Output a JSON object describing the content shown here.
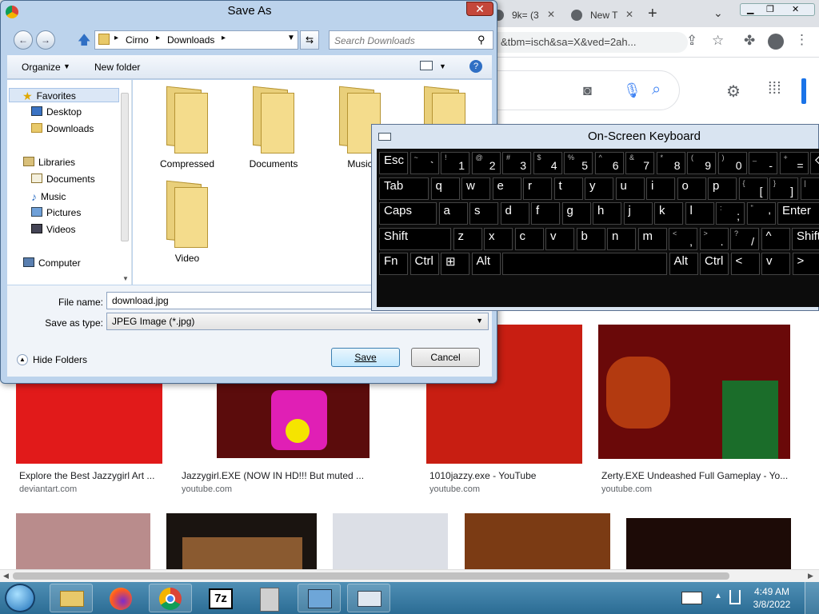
{
  "browser": {
    "tabs": [
      {
        "label": ""
      },
      {
        "label": ""
      },
      {
        "label": ""
      },
      {
        "label": ""
      },
      {
        "label": ""
      },
      {
        "label": "9k= (3"
      },
      {
        "label": "New T"
      }
    ],
    "new_tab_label": "+",
    "address": "&tbm=isch&sa=X&ved=2ah..."
  },
  "results": [
    {
      "caption": "Explore the Best Jazzygirl Art ...",
      "source": "deviantart.com",
      "color": "#e11a1a"
    },
    {
      "caption": "Jazzygirl.EXE (NOW IN HD!!! But muted ...",
      "source": "youtube.com",
      "color": "#5b0c0c"
    },
    {
      "caption": "1010jazzy.exe - YouTube",
      "source": "youtube.com",
      "color": "#c81e12"
    },
    {
      "caption": "Zerty.EXE Undeashed Full Gameplay - Yo...",
      "source": "youtube.com",
      "color": "#6a0909"
    }
  ],
  "dialog": {
    "title": "Save As",
    "close": "✕",
    "path": [
      "Cirno",
      "Downloads"
    ],
    "search_placeholder": "Search Downloads",
    "organize": "Organize",
    "new_folder": "New folder",
    "nav": {
      "favorites": "Favorites",
      "desktop": "Desktop",
      "downloads": "Downloads",
      "libraries": "Libraries",
      "documents": "Documents",
      "music": "Music",
      "pictures": "Pictures",
      "videos": "Videos",
      "computer": "Computer"
    },
    "folders": [
      "Compressed",
      "Documents",
      "Music",
      "",
      "Video"
    ],
    "file_name_label": "File name:",
    "file_name_value": "download.jpg",
    "save_type_label": "Save as type:",
    "save_type_value": "JPEG Image (*.jpg)",
    "hide_folders": "Hide Folders",
    "save": "Save",
    "cancel": "Cancel"
  },
  "osk": {
    "title": "On-Screen Keyboard",
    "rows": [
      [
        {
          "t": "Esc"
        },
        {
          "t": "~",
          "b": "`"
        },
        {
          "t": "!",
          "b": "1"
        },
        {
          "t": "@",
          "b": "2"
        },
        {
          "t": "#",
          "b": "3"
        },
        {
          "t": "$",
          "b": "4"
        },
        {
          "t": "%",
          "b": "5"
        },
        {
          "t": "^",
          "b": "6"
        },
        {
          "t": "&",
          "b": "7"
        },
        {
          "t": "*",
          "b": "8"
        },
        {
          "t": "(",
          "b": "9"
        },
        {
          "t": ")",
          "b": "0"
        },
        {
          "t": "_",
          "b": "-"
        },
        {
          "t": "+",
          "b": "="
        },
        {
          "t": "⌫"
        }
      ],
      [
        {
          "t": "Tab"
        },
        {
          "t": "q"
        },
        {
          "t": "w"
        },
        {
          "t": "e"
        },
        {
          "t": "r"
        },
        {
          "t": "t"
        },
        {
          "t": "y"
        },
        {
          "t": "u"
        },
        {
          "t": "i"
        },
        {
          "t": "o"
        },
        {
          "t": "p"
        },
        {
          "t": "{",
          "b": "["
        },
        {
          "t": "}",
          "b": "]"
        },
        {
          "t": "|",
          "b": "\\"
        }
      ],
      [
        {
          "t": "Caps"
        },
        {
          "t": "a"
        },
        {
          "t": "s"
        },
        {
          "t": "d"
        },
        {
          "t": "f"
        },
        {
          "t": "g"
        },
        {
          "t": "h"
        },
        {
          "t": "j"
        },
        {
          "t": "k"
        },
        {
          "t": "l"
        },
        {
          "t": ":",
          "b": ";"
        },
        {
          "t": "\"",
          "b": "'"
        },
        {
          "t": "Enter"
        }
      ],
      [
        {
          "t": "Shift"
        },
        {
          "t": "z"
        },
        {
          "t": "x"
        },
        {
          "t": "c"
        },
        {
          "t": "v"
        },
        {
          "t": "b"
        },
        {
          "t": "n"
        },
        {
          "t": "m"
        },
        {
          "t": "<",
          "b": ","
        },
        {
          "t": ">",
          "b": "."
        },
        {
          "t": "?",
          "b": "/"
        },
        {
          "t": "^"
        },
        {
          "t": "Shift"
        }
      ],
      [
        {
          "t": "Fn"
        },
        {
          "t": "Ctrl"
        },
        {
          "t": "⊞"
        },
        {
          "t": "Alt"
        },
        {
          "t": ""
        },
        {
          "t": "Alt"
        },
        {
          "t": "Ctrl"
        },
        {
          "t": "<"
        },
        {
          "t": "v"
        },
        {
          "t": ">"
        }
      ]
    ]
  },
  "taskbar": {
    "time": "4:49 AM",
    "date": "3/8/2022",
    "apps": [
      "explorer",
      "firefox",
      "chrome",
      "7z",
      "cabinet",
      "control-panel",
      "osk"
    ]
  }
}
